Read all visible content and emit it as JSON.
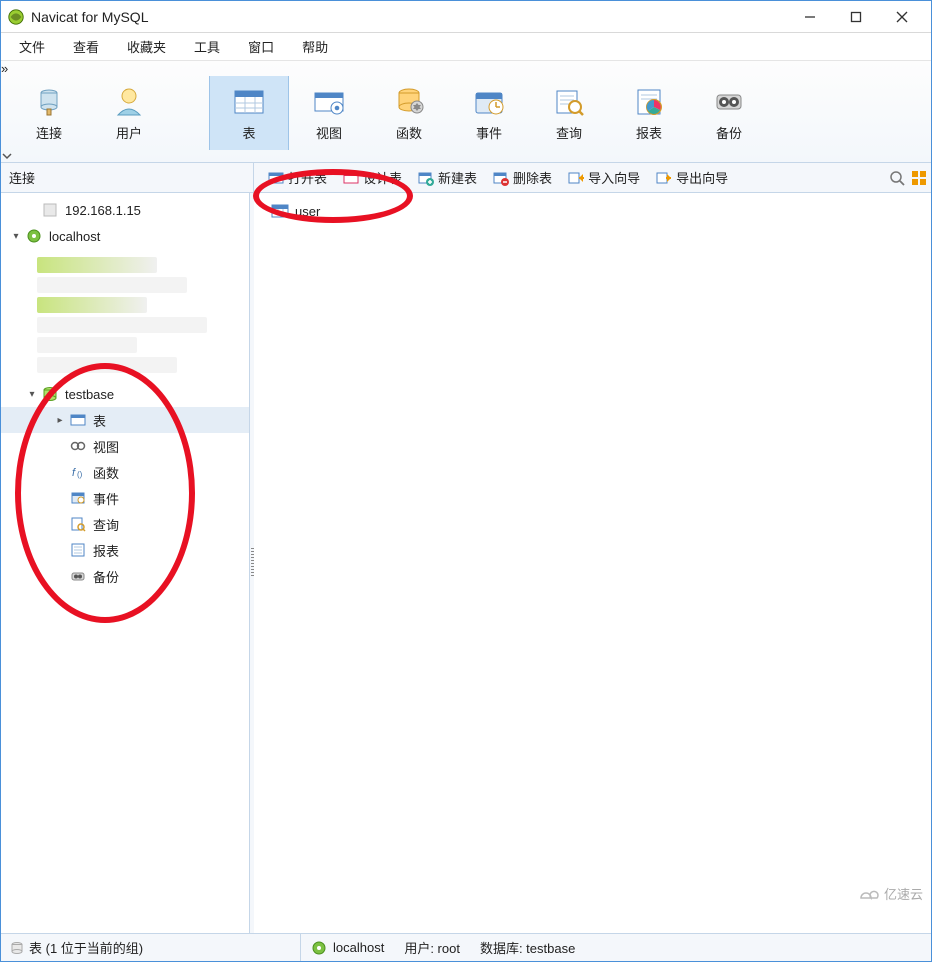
{
  "app": {
    "title": "Navicat for MySQL"
  },
  "menubar": {
    "items": [
      "文件",
      "查看",
      "收藏夹",
      "工具",
      "窗口",
      "帮助"
    ]
  },
  "maintoolbar": {
    "items": [
      {
        "label": "连接",
        "icon": "connection-icon",
        "selected": false
      },
      {
        "label": "用户",
        "icon": "user-icon",
        "selected": false
      },
      {
        "label": "表",
        "icon": "table-icon",
        "selected": true
      },
      {
        "label": "视图",
        "icon": "view-icon",
        "selected": false
      },
      {
        "label": "函数",
        "icon": "function-icon",
        "selected": false
      },
      {
        "label": "事件",
        "icon": "event-icon",
        "selected": false
      },
      {
        "label": "查询",
        "icon": "query-icon",
        "selected": false
      },
      {
        "label": "报表",
        "icon": "report-icon",
        "selected": false
      },
      {
        "label": "备份",
        "icon": "backup-icon",
        "selected": false
      }
    ]
  },
  "navbar": {
    "left_label": "连接",
    "buttons": [
      {
        "label": "打开表",
        "icon": "open-table-icon"
      },
      {
        "label": "设计表",
        "icon": "design-table-icon"
      },
      {
        "label": "新建表",
        "icon": "new-table-icon"
      },
      {
        "label": "删除表",
        "icon": "delete-table-icon"
      },
      {
        "label": "导入向导",
        "icon": "import-wizard-icon"
      },
      {
        "label": "导出向导",
        "icon": "export-wizard-icon"
      }
    ]
  },
  "tree": {
    "conn1_label": "192.168.1.15",
    "conn2_label": "localhost",
    "db_label": "testbase",
    "db_children": [
      {
        "label": "表",
        "icon": "table-icon",
        "selected": true,
        "has_twisty": true
      },
      {
        "label": "视图",
        "icon": "view-node-icon",
        "selected": false,
        "has_twisty": false
      },
      {
        "label": "函数",
        "icon": "fn-node-icon",
        "selected": false,
        "has_twisty": false
      },
      {
        "label": "事件",
        "icon": "event-node-icon",
        "selected": false,
        "has_twisty": false
      },
      {
        "label": "查询",
        "icon": "query-node-icon",
        "selected": false,
        "has_twisty": false
      },
      {
        "label": "报表",
        "icon": "report-node-icon",
        "selected": false,
        "has_twisty": false
      },
      {
        "label": "备份",
        "icon": "backup-node-icon",
        "selected": false,
        "has_twisty": false
      }
    ]
  },
  "content": {
    "items": [
      {
        "label": "user"
      }
    ]
  },
  "statusbar": {
    "left": "表 (1 位于当前的组)",
    "right_host_label": "localhost",
    "right_user_label": "用户: root",
    "right_db_label": "数据库: testbase"
  },
  "watermark": {
    "text": "亿速云"
  }
}
